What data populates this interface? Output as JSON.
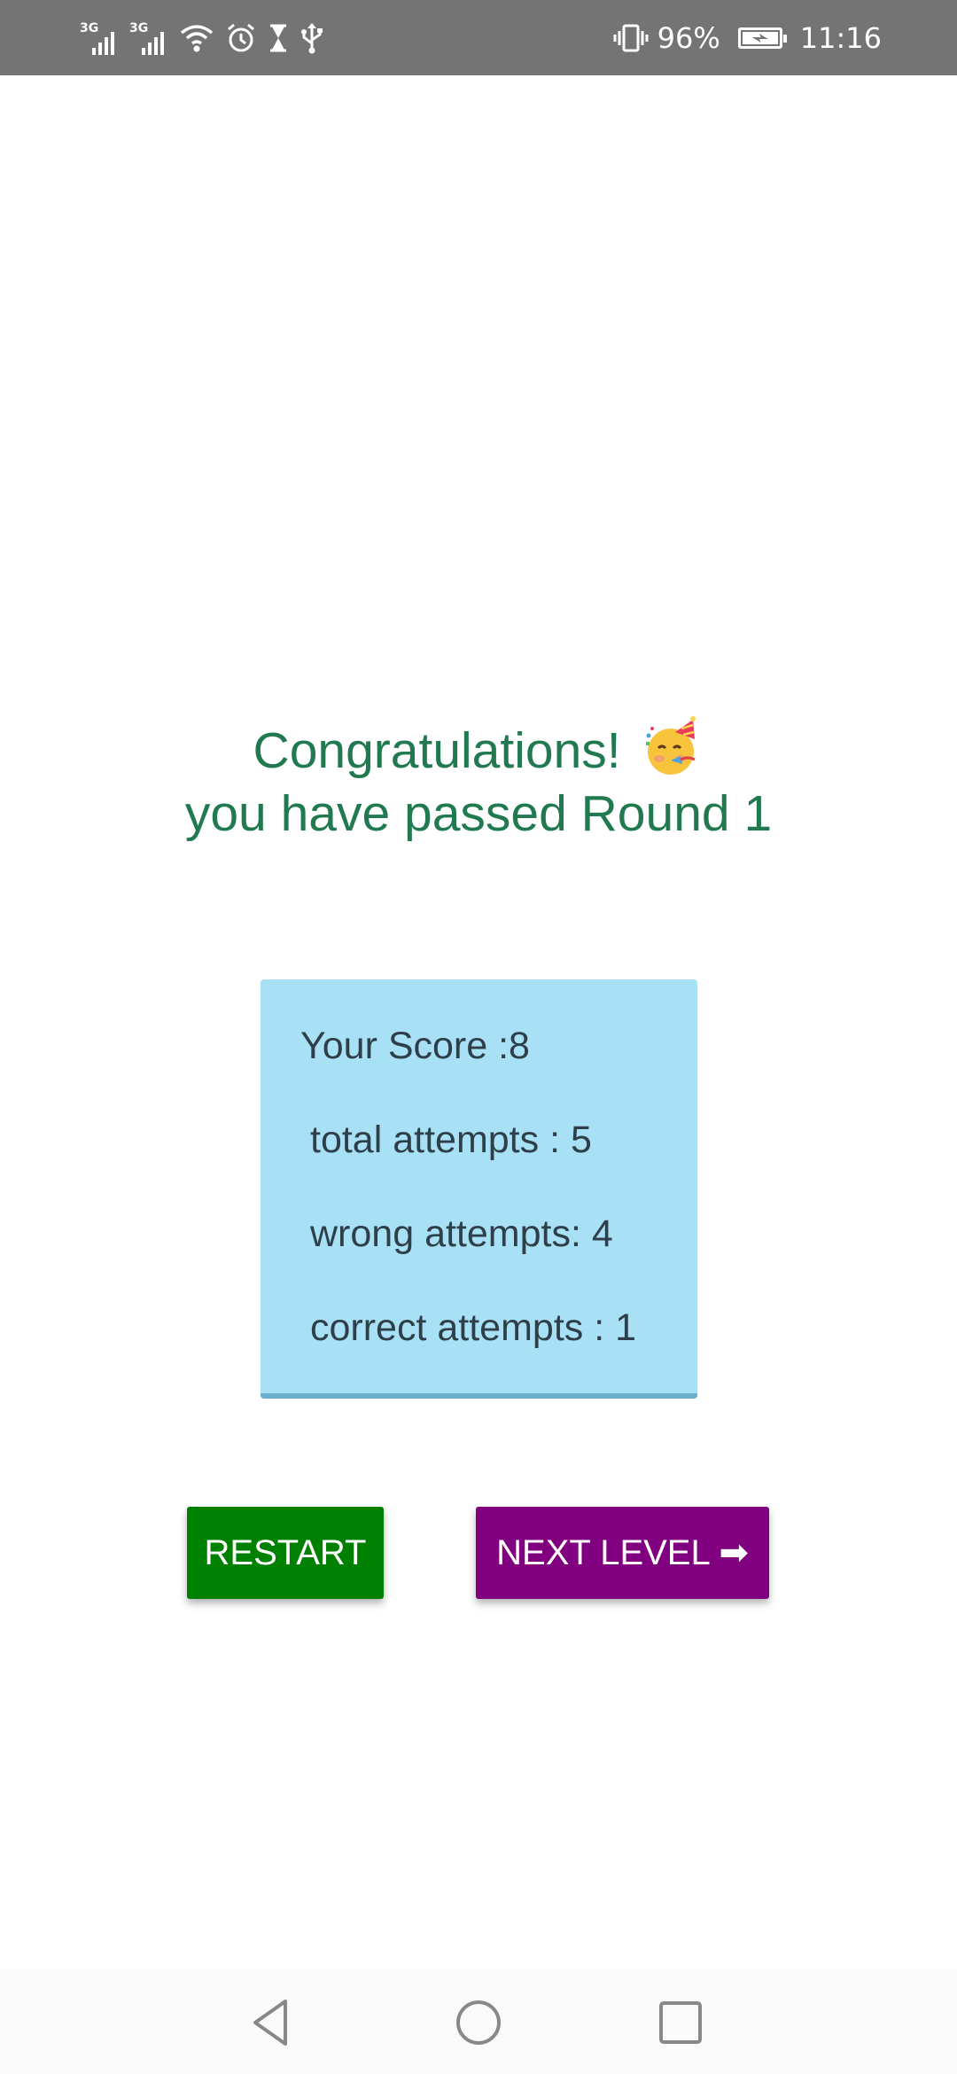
{
  "status_bar": {
    "sim1_label": "3G",
    "sim2_label": "3G",
    "battery_percent": "96%",
    "time": "11:16",
    "icons": [
      "signal-sim1-icon",
      "signal-sim2-icon",
      "wifi-icon",
      "alarm-icon",
      "hourglass-icon",
      "usb-icon",
      "vibrate-icon",
      "battery-charging-icon"
    ]
  },
  "congrats": {
    "line1": "Congratulations!",
    "emoji": "party-face-emoji",
    "line2": "you have passed Round 1"
  },
  "score": {
    "your_score": "Your Score :8",
    "total_attempts": "total attempts : 5",
    "wrong_attempts": "wrong attempts: 4",
    "correct_attempts": "correct attempts : 1"
  },
  "buttons": {
    "restart": "RESTART",
    "next_level": "NEXT LEVEL ➡"
  },
  "nav": {
    "icons": [
      "back-icon",
      "home-icon",
      "recents-icon"
    ]
  },
  "colors": {
    "title": "#217a4f",
    "score_card": "#a8e1f5",
    "restart": "#008000",
    "next_level": "#800080",
    "status_bar": "#747474"
  }
}
